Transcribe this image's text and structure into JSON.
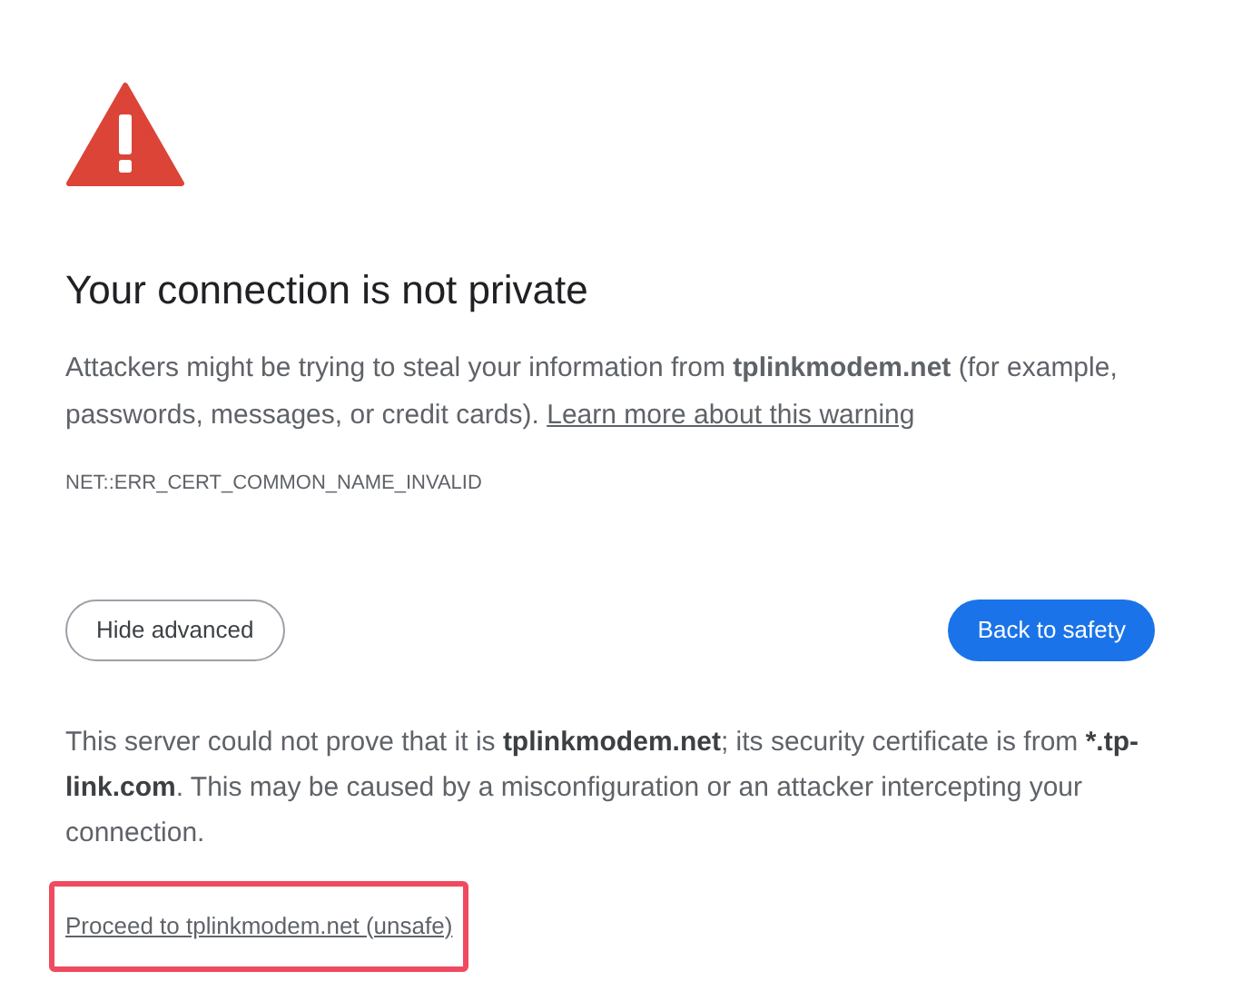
{
  "title": "Your connection is not private",
  "description": "Attackers might be trying to steal your information from **tplinkmodem.net** (for example, passwords, messages, or credit cards).",
  "learn_more_link": "Learn more about this warning",
  "error_code": "NET::ERR_CERT_COMMON_NAME_INVALID",
  "buttons": [
    {
      "label": "Hide advanced",
      "kind": "secondary"
    },
    {
      "label": "Back to safety",
      "kind": "primary"
    }
  ],
  "details": "This server could not prove that it is **tplinkmodem.net**; its security certificate is from ***.tp-link.com**. This may be caused by a misconfiguration or an attacker intercepting your connection.",
  "proceed_link": {
    "label": "Proceed to tplinkmodem.net (unsafe)",
    "highlighted": true
  }
}
